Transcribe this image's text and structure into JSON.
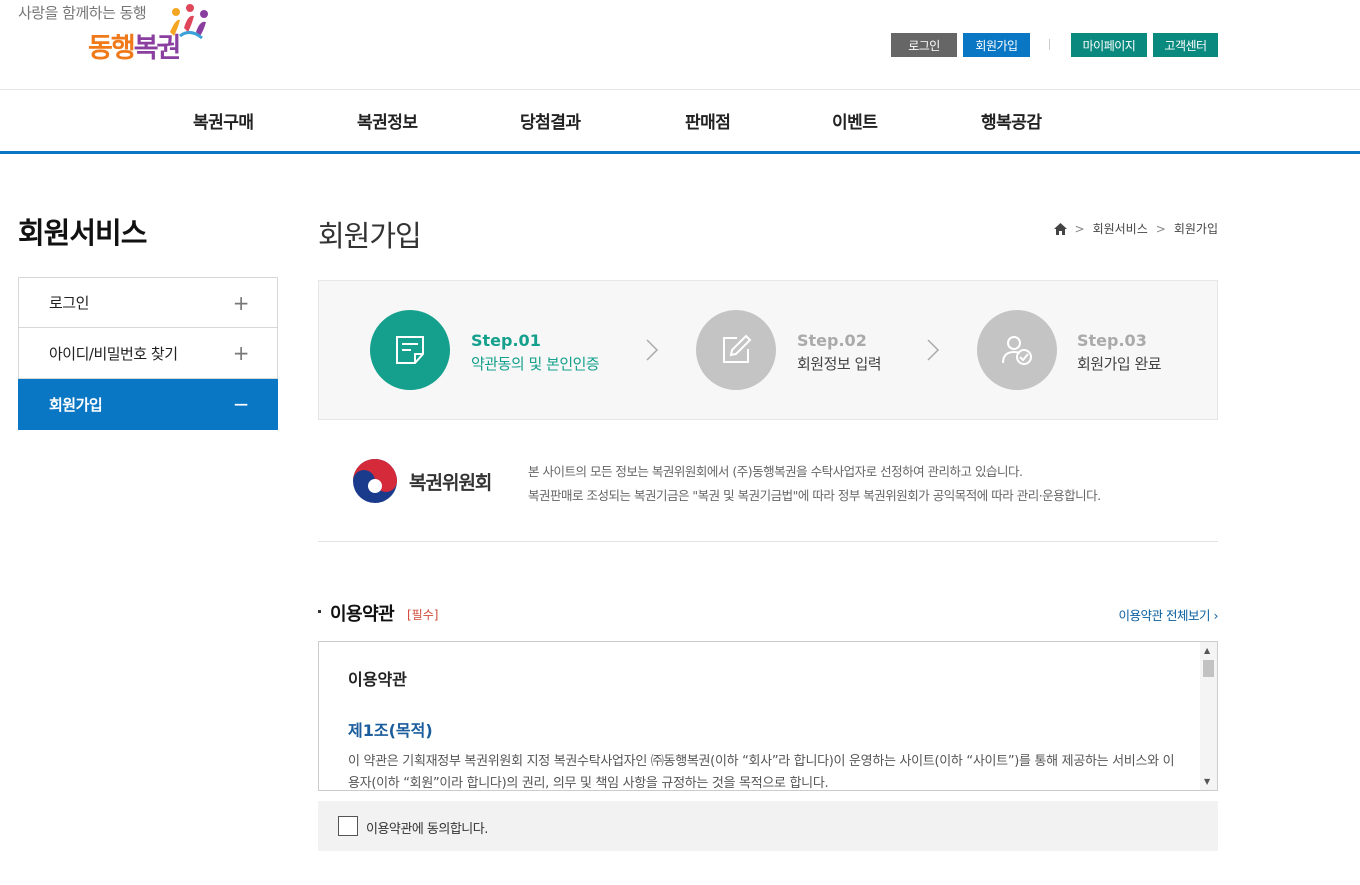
{
  "header": {
    "slogan": "사랑을 함께하는 동행",
    "logo_part1": "동행",
    "logo_part2": "복권",
    "util": {
      "login": "로그인",
      "join": "회원가입",
      "mypage": "마이페이지",
      "customer_center": "고객센터"
    }
  },
  "gnb": {
    "items": [
      "복권구매",
      "복권정보",
      "당첨결과",
      "판매점",
      "이벤트",
      "행복공감"
    ]
  },
  "lnb": {
    "title": "회원서비스",
    "items": [
      {
        "label": "로그인",
        "sign": "+"
      },
      {
        "label": "아이디/비밀번호 찾기",
        "sign": "+"
      },
      {
        "label": "회원가입",
        "sign": "−"
      }
    ]
  },
  "content": {
    "page_title": "회원가입",
    "breadcrumb": [
      "회원서비스",
      "회원가입"
    ],
    "steps": [
      {
        "no": "Step.01",
        "text": "약관동의 및 본인인증",
        "icon": "document-icon"
      },
      {
        "no": "Step.02",
        "text": "회원정보 입력",
        "icon": "edit-icon"
      },
      {
        "no": "Step.03",
        "text": "회원가입 완료",
        "icon": "user-check-icon"
      }
    ],
    "notice": {
      "org_name": "복권위원회",
      "line1": "본 사이트의 모든 정보는 복권위원회에서 (주)동행복권을 수탁사업자로 선정하여 관리하고 있습니다.",
      "line2": "복권판매로 조성되는 복권기금은 \"복권 및 복권기금법\"에 따라 정부 복권위원회가 공익목적에 따라 관리·운용합니다."
    },
    "terms": {
      "section_title": "이용약관",
      "required": "[필수]",
      "view_all": "이용약관 전체보기",
      "heading": "이용약관",
      "article_title": "제1조(목적)",
      "article_body": "이 약관은 기획재정부 복권위원회 지정 복권수탁사업자인 ㈜동행복권(이하 “회사”라 합니다)이 운영하는 사이트(이하 “사이트”)를 통해 제공하는 서비스와 이용자(이하 “회원”이라 합니다)의 권리, 의무 및 책임 사항을 규정하는 것을 목적으로 합니다.",
      "agree_label": "이용약관에 동의합니다."
    }
  },
  "colors": {
    "primary_blue": "#0a77c4",
    "teal": "#0a8a7f",
    "step_active": "#14a08c",
    "step_inactive": "#c4c4c4"
  }
}
